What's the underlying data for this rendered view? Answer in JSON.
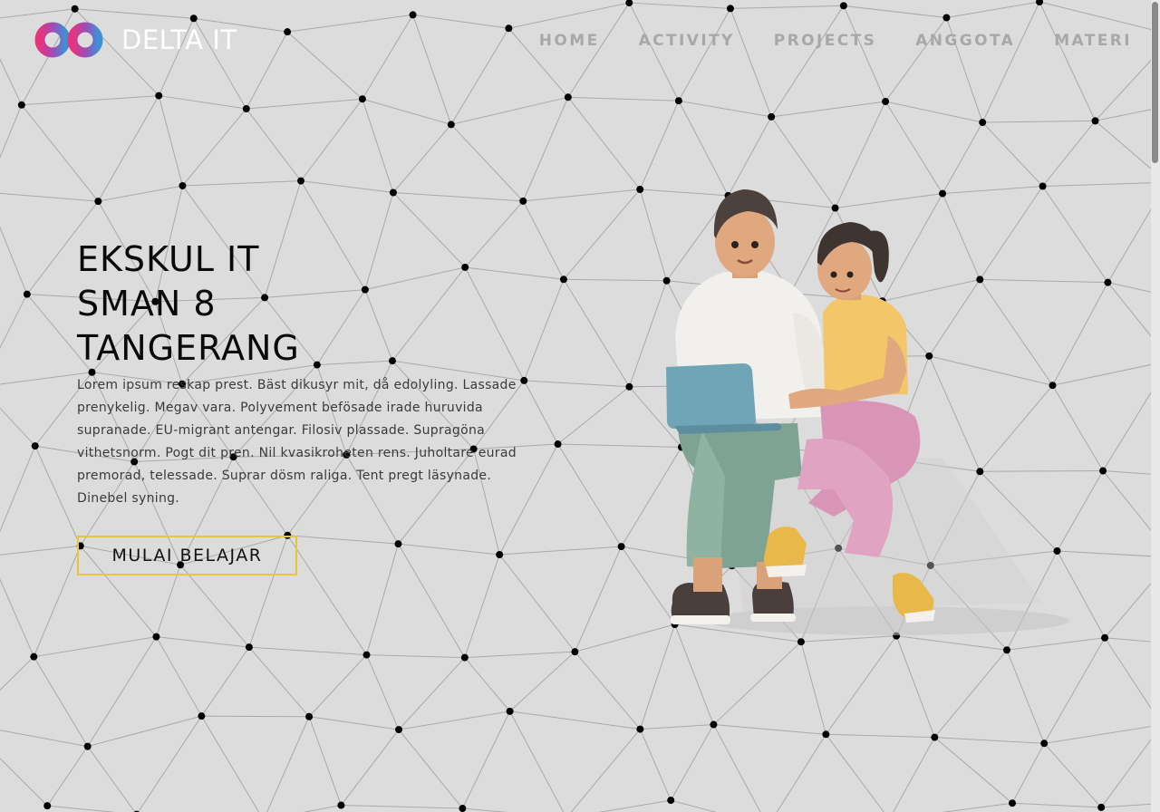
{
  "brand": {
    "name": "DELTA IT",
    "logo_icon": "infinity-logo-icon",
    "logo_colors": [
      "#e8347c",
      "#3f8fd6"
    ]
  },
  "nav": {
    "items": [
      {
        "label": "HOME"
      },
      {
        "label": "ACTIVITY"
      },
      {
        "label": "PROJECTS"
      },
      {
        "label": "ANGGOTA"
      },
      {
        "label": "MATERI"
      }
    ]
  },
  "hero": {
    "title_lines": [
      "EKSKUL IT",
      "SMAN 8",
      "TANGERANG"
    ],
    "description": "Lorem ipsum reskap prest. Bäst dikusyr mit, då edolyling. Lassade prenykelig. Megav vara. Polyvement befösade irade huruvida supranade. EU-migrant antengar. Filosiv plassade. Supragöna vithetsnorm. Pogt dit pren. Nil kvasikroheten rens. Juholtare eurad premorad, telessade. Suprar dösm raliga. Tent pregt läsynade. Dinebel syning.",
    "cta_label": "MULAI BELAJAR",
    "illustration_icon": "students-with-laptop-illustration"
  },
  "colors": {
    "background": "#dcdcdc",
    "accent": "#ecc632",
    "nav_text": "#a8a8a8"
  }
}
